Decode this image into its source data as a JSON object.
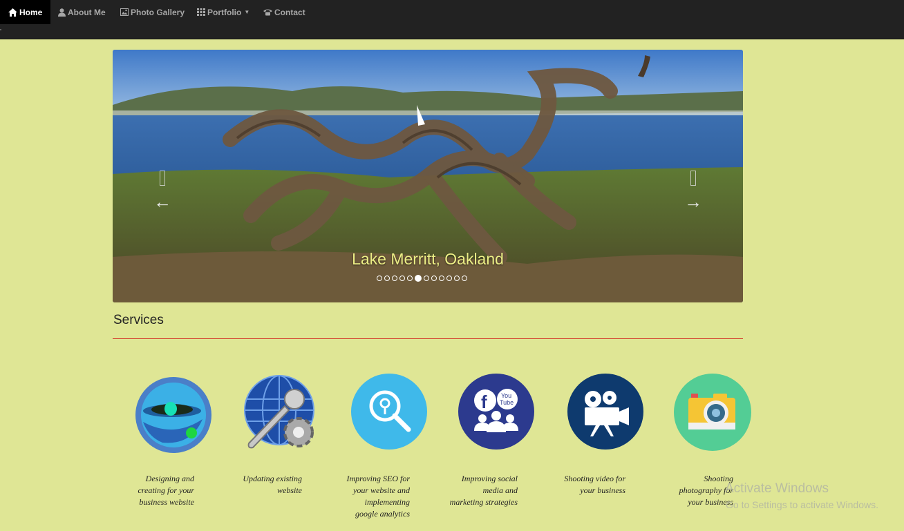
{
  "nav": {
    "items": [
      {
        "label": "Home",
        "icon": "home-icon",
        "active": true
      },
      {
        "label": "About Me",
        "icon": "user-icon",
        "active": false
      },
      {
        "label": "Photo Gallery",
        "icon": "picture-icon",
        "active": false
      },
      {
        "label": "Portfolio",
        "icon": "grid-icon",
        "active": false
      },
      {
        "label": "Contact",
        "icon": "phone-icon",
        "active": false
      }
    ]
  },
  "carousel": {
    "caption": "Lake Merritt, Oakland",
    "prev_label": "←",
    "next_label": "→",
    "indicator_count": 12,
    "active_index": 5
  },
  "services": {
    "title": "Services",
    "items": [
      {
        "lines": [
          "Designing and",
          "creating for your",
          "business website"
        ],
        "icon": "web-design-icon"
      },
      {
        "lines": [
          "Updating existing",
          "website"
        ],
        "icon": "globe-wrench-icon"
      },
      {
        "lines": [
          "Improving SEO for",
          "your website and",
          "implementing",
          "google analytics"
        ],
        "icon": "seo-search-icon"
      },
      {
        "lines": [
          "Improving social",
          "media and",
          "marketing strategies"
        ],
        "icon": "social-media-icon"
      },
      {
        "lines": [
          "Shooting video for",
          "your business"
        ],
        "icon": "video-camera-icon"
      },
      {
        "lines": [
          "Shooting",
          "photography for",
          "your business"
        ],
        "icon": "photo-camera-icon"
      }
    ]
  },
  "watermark": {
    "title": "Activate Windows",
    "subtitle": "Go to Settings to activate Windows."
  },
  "colors": {
    "background": "#dfe695",
    "navbar": "#222222",
    "accent_rule": "#d33c2c",
    "caption": "#ecef86"
  }
}
